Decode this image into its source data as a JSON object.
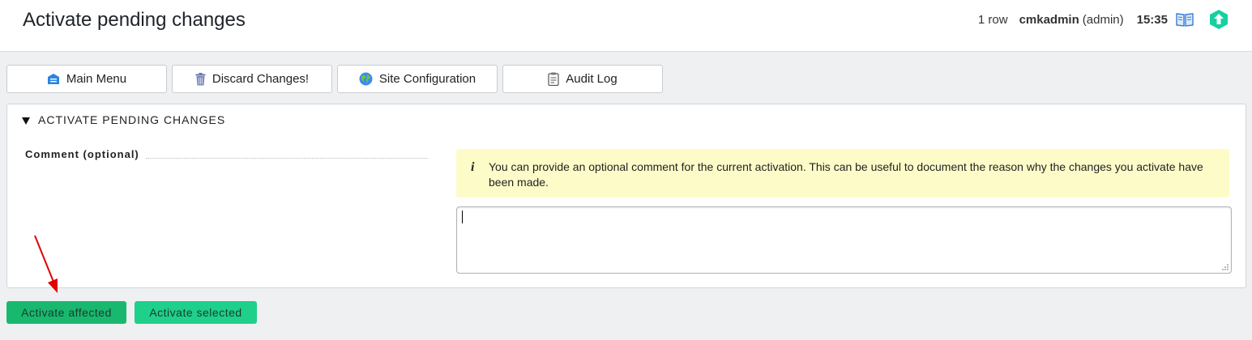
{
  "header": {
    "title": "Activate pending changes",
    "row_count": "1 row",
    "user_name": "cmkadmin",
    "user_role": "(admin)",
    "time": "15:35"
  },
  "menu": {
    "buttons": [
      {
        "label": "Main Menu",
        "icon": "main-menu-icon"
      },
      {
        "label": "Discard Changes!",
        "icon": "trash-icon"
      },
      {
        "label": "Site Configuration",
        "icon": "globe-icon"
      },
      {
        "label": "Audit Log",
        "icon": "clipboard-icon"
      }
    ]
  },
  "section": {
    "title": "ACTIVATE PENDING CHANGES",
    "comment_label": "Comment (optional)",
    "info_text": "You can provide an optional comment for the current activation. This can be useful to document the reason why the changes you activate have been made.",
    "comment_value": ""
  },
  "actions": {
    "activate_affected": "Activate affected",
    "activate_selected": "Activate selected"
  },
  "colors": {
    "accent_green": "#19b86f",
    "accent_green_light": "#1fd08a",
    "info_background": "#fdfcc8",
    "annotation_arrow": "#e00000"
  }
}
